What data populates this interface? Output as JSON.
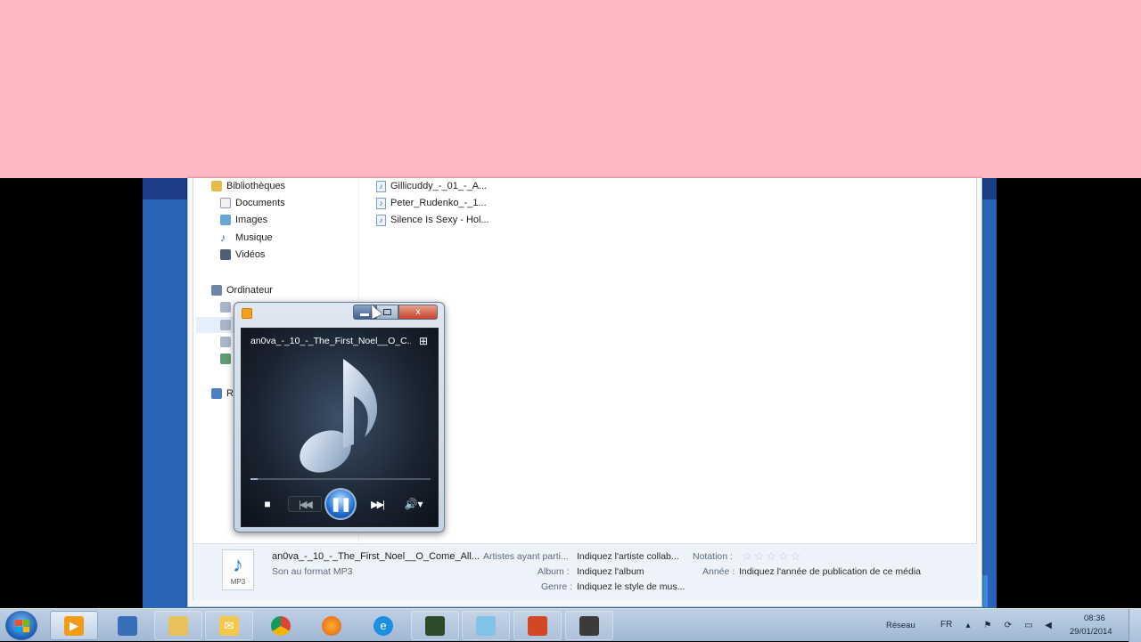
{
  "nav": {
    "libraries": "Bibliothèques",
    "documents": "Documents",
    "images": "Images",
    "music": "Musique",
    "videos": "Vidéos",
    "computer": "Ordinateur",
    "network_partial": "R"
  },
  "files": [
    {
      "name": "Gillicuddy_-_01_-_A..."
    },
    {
      "name": "Peter_Rudenko_-_1..."
    },
    {
      "name": "Silence Is Sexy - Hol..."
    }
  ],
  "details": {
    "file_title": "an0va_-_10_-_The_First_Noel__O_Come_All...",
    "file_type": "Son au format MP3",
    "thumb_format": "MP3",
    "contributing_artists_label": "Artistes ayant parti...",
    "contributing_artists_value": "Indiquez l'artiste collab...",
    "album_label": "Album :",
    "album_value": "Indiquez l'album",
    "genre_label": "Genre :",
    "genre_value": "Indiquez le style de mus...",
    "rating_label": "Notation :",
    "rating_stars": 0,
    "year_label": "Année :",
    "year_value": "Indiquez l'année de publication de ce média"
  },
  "player": {
    "track_title": "an0va_-_10_-_The_First_Noel__O_C...",
    "state": "playing",
    "progress": 0.04,
    "close_glyph": "x",
    "icons": {
      "stop": "■",
      "prev": "|◀◀",
      "pause": "❚❚",
      "next": "▶▶|",
      "volume": "🔊▾",
      "switch_view": "⊞"
    }
  },
  "taskbar": {
    "network_label": "Réseau",
    "language": "FR",
    "time": "08:36",
    "date": "29/01/2014",
    "apps": [
      "windows-media-player",
      "remote-desktop",
      "file-explorer",
      "outlook",
      "chrome",
      "firefox",
      "internet-explorer",
      "app-green",
      "app-notes",
      "powerpoint",
      "app-x"
    ]
  },
  "colors": {
    "pink_band": "#ffb8c1",
    "desktop": "#2a64b8",
    "player_accent": "#1f6fd1"
  }
}
